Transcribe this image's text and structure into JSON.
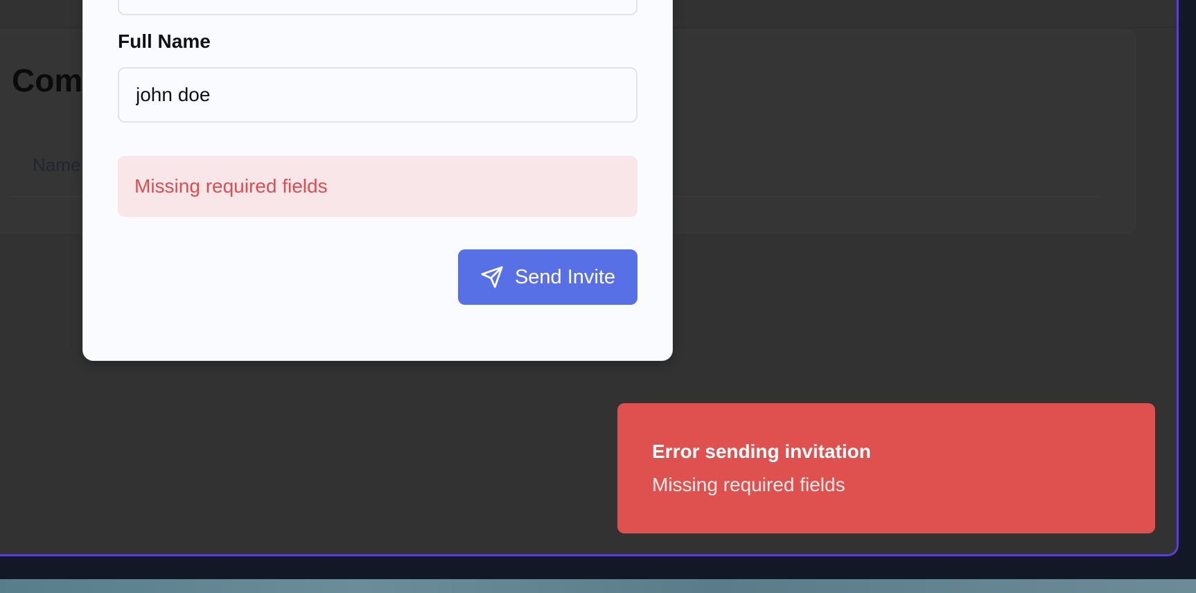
{
  "background_page": {
    "card_title": "Comp",
    "column_header": "Name"
  },
  "modal": {
    "full_name_label": "Full Name",
    "full_name_value": "john doe",
    "error_message": "Missing required fields",
    "send_button_label": "Send Invite",
    "send_icon": "send-icon"
  },
  "toast": {
    "title": "Error sending invitation",
    "message": "Missing required fields"
  },
  "colors": {
    "accent_border": "#5b3fd1",
    "primary_button": "#5870e6",
    "error_text": "#de4e50",
    "error_background": "#f9e6e9",
    "toast_background": "#de514e",
    "overlay_background": "#323232"
  }
}
